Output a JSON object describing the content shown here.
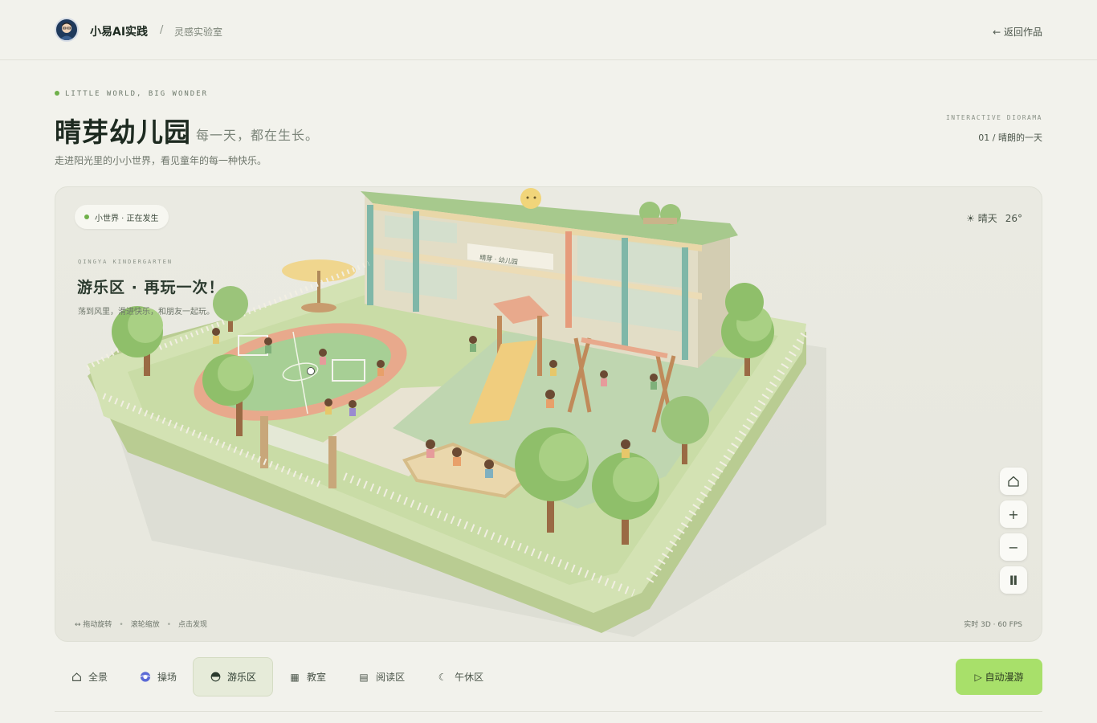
{
  "header": {
    "brand": "小易AI实践",
    "separator": "/",
    "crumb": "灵感实验室",
    "back": "← 返回作品"
  },
  "hero": {
    "eyebrow": "LITTLE WORLD, BIG WONDER",
    "title": "晴芽幼儿园",
    "subtitle": "每一天，都在生长。",
    "description": "走进阳光里的小小世界，看见童年的每一种快乐。",
    "meta_label": "INTERACTIVE DIORAMA",
    "meta_value": "01 / 晴朗的一天"
  },
  "scene": {
    "status": "小世界 · 正在发生",
    "weather_icon": "sun-icon",
    "weather": "☀ 晴天",
    "temperature": "26°",
    "zone_eyebrow": "QINGYA KINDERGARTEN",
    "zone_title": "游乐区 · 再玩一次！",
    "zone_desc": "荡到风里，滑进快乐，和朋友一起玩。",
    "sign_text": "晴芽 · 幼儿园",
    "hints": [
      "↔ 拖动旋转",
      "滚轮缩放",
      "点击发现"
    ],
    "hint_separator": "•",
    "fps": "实时 3D · 60 FPS",
    "controls": [
      {
        "name": "home-view-button",
        "icon": "home-icon",
        "glyph": "⌂"
      },
      {
        "name": "zoom-in-button",
        "icon": "plus-icon",
        "glyph": "+"
      },
      {
        "name": "zoom-out-button",
        "icon": "minus-icon",
        "glyph": "−"
      },
      {
        "name": "reset-button",
        "icon": "pillar-icon",
        "glyph": "Ⅱ"
      }
    ]
  },
  "tabs": [
    {
      "label": "全景",
      "icon": "home-icon",
      "glyph": "⌂",
      "active": false
    },
    {
      "label": "操场",
      "icon": "ball-icon",
      "glyph": "●",
      "active": false
    },
    {
      "label": "游乐区",
      "icon": "slide-icon",
      "glyph": "◓",
      "active": true
    },
    {
      "label": "教室",
      "icon": "grid-icon",
      "glyph": "▦",
      "active": false
    },
    {
      "label": "阅读区",
      "icon": "book-icon",
      "glyph": "▤",
      "active": false
    },
    {
      "label": "午休区",
      "icon": "moon-icon",
      "glyph": "☾",
      "active": false
    }
  ],
  "auto_tour": "▷ 自动漫游",
  "colors": {
    "accent": "#a8e06a",
    "background": "#f2f2ec",
    "grass": "#c9dca6",
    "track": "#e8a98c"
  }
}
